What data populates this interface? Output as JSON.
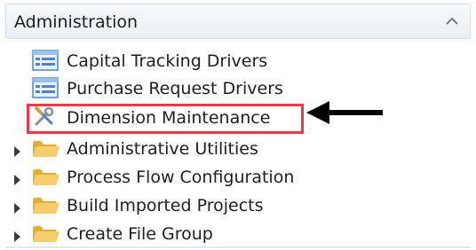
{
  "panel": {
    "title": "Administration",
    "collapse_icon": "chevron-up-icon"
  },
  "tree": {
    "items": [
      {
        "label": "Capital Tracking Drivers",
        "icon": "list-report-icon",
        "expandable": false
      },
      {
        "label": "Purchase Request Drivers",
        "icon": "list-report-icon",
        "expandable": false
      },
      {
        "label": "Dimension Maintenance",
        "icon": "tools-icon",
        "expandable": false,
        "highlighted": true
      },
      {
        "label": "Administrative Utilities",
        "icon": "folder-icon",
        "expandable": true
      },
      {
        "label": "Process Flow Configuration",
        "icon": "folder-icon",
        "expandable": true
      },
      {
        "label": "Build Imported Projects",
        "icon": "folder-icon",
        "expandable": true
      },
      {
        "label": "Create File Group",
        "icon": "folder-icon",
        "expandable": true
      }
    ]
  },
  "annotation": {
    "highlight_color": "#e53b49",
    "arrow_color": "#000000",
    "arrow_icon": "arrow-left-icon"
  }
}
